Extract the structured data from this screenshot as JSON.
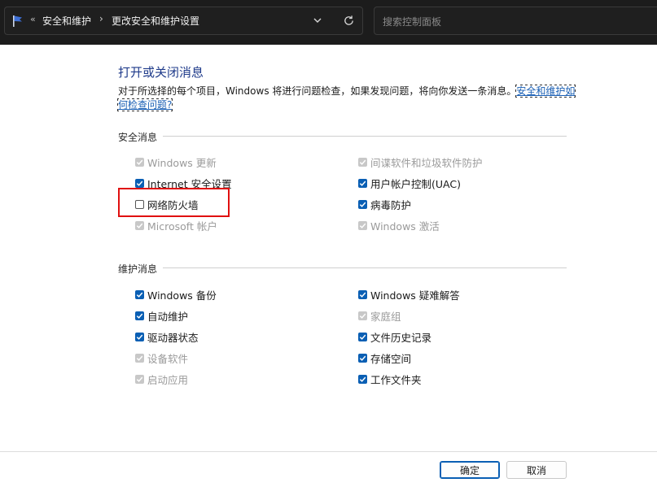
{
  "address_bar": {
    "nav_arrows": "«",
    "crumb1": "安全和维护",
    "separator": "›",
    "crumb2": "更改安全和维护设置"
  },
  "search": {
    "placeholder": "搜索控制面板"
  },
  "main": {
    "title": "打开或关闭消息",
    "description": "对于所选择的每个项目，Windows 将进行问题检查，如果发现问题，将向你发送一条消息。",
    "link": "安全和维护如何检查问题?"
  },
  "security": {
    "heading": "安全消息",
    "left": [
      {
        "label": "Windows 更新",
        "state": "disabled"
      },
      {
        "label": "Internet 安全设置",
        "state": "checked"
      },
      {
        "label": "网络防火墙",
        "state": "unchecked"
      },
      {
        "label": "Microsoft 帐户",
        "state": "disabled"
      }
    ],
    "right": [
      {
        "label": "间谍软件和垃圾软件防护",
        "state": "disabled"
      },
      {
        "label": "用户帐户控制(UAC)",
        "state": "checked"
      },
      {
        "label": "病毒防护",
        "state": "checked"
      },
      {
        "label": "Windows 激活",
        "state": "disabled"
      }
    ]
  },
  "maintenance": {
    "heading": "维护消息",
    "left": [
      {
        "label": "Windows 备份",
        "state": "checked"
      },
      {
        "label": "自动维护",
        "state": "checked"
      },
      {
        "label": "驱动器状态",
        "state": "checked"
      },
      {
        "label": "设备软件",
        "state": "disabled"
      },
      {
        "label": "启动应用",
        "state": "disabled"
      }
    ],
    "right": [
      {
        "label": "Windows 疑难解答",
        "state": "checked"
      },
      {
        "label": "家庭组",
        "state": "disabled"
      },
      {
        "label": "文件历史记录",
        "state": "checked"
      },
      {
        "label": "存储空间",
        "state": "checked"
      },
      {
        "label": "工作文件夹",
        "state": "checked"
      }
    ]
  },
  "buttons": {
    "ok": "确定",
    "cancel": "取消"
  },
  "colors": {
    "accent": "#0a5fb4",
    "highlight": "#e01010",
    "title": "#1e3a8a"
  }
}
